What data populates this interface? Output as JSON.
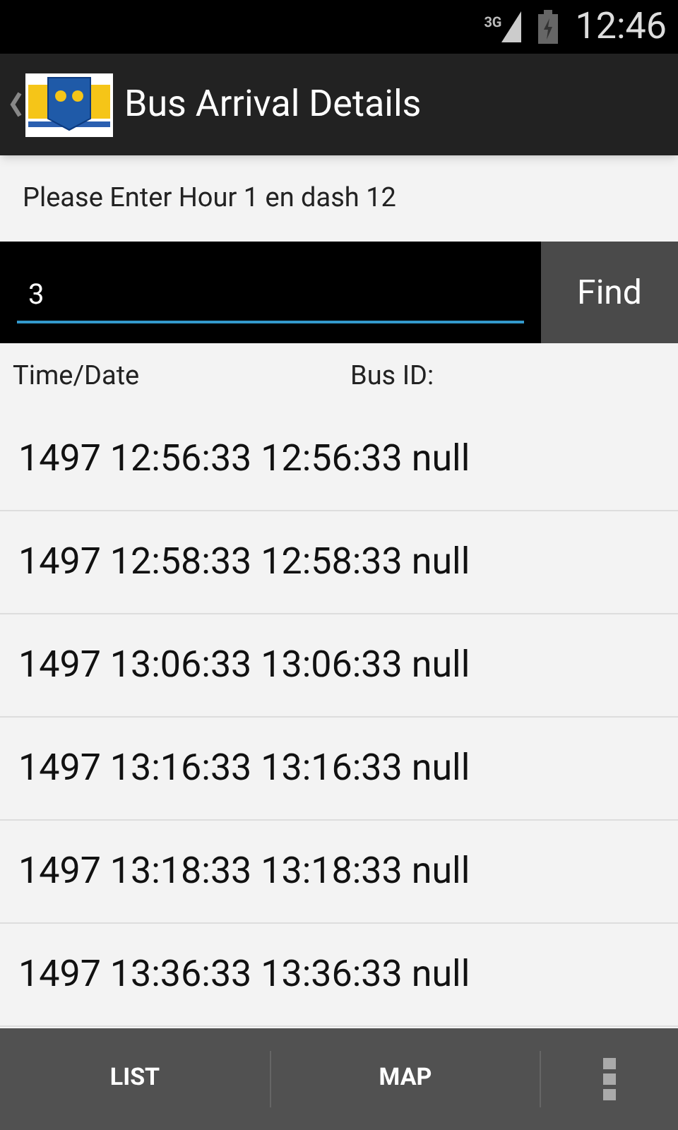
{
  "status_bar": {
    "network": "3G",
    "time": "12:46"
  },
  "action_bar": {
    "title": "Bus Arrival Details"
  },
  "prompt": "Please Enter Hour 1 en dash 12",
  "search": {
    "value": "3",
    "button": "Find"
  },
  "table": {
    "columns": [
      "Time/Date",
      "Bus ID:"
    ],
    "rows": [
      "1497 12:56:33 12:56:33 null",
      "1497 12:58:33 12:58:33 null",
      "1497 13:06:33 13:06:33 null",
      "1497 13:16:33 13:16:33 null",
      "1497 13:18:33 13:18:33 null",
      "1497 13:36:33 13:36:33 null"
    ]
  },
  "bottom_bar": {
    "items": [
      "LIST",
      "MAP"
    ]
  }
}
